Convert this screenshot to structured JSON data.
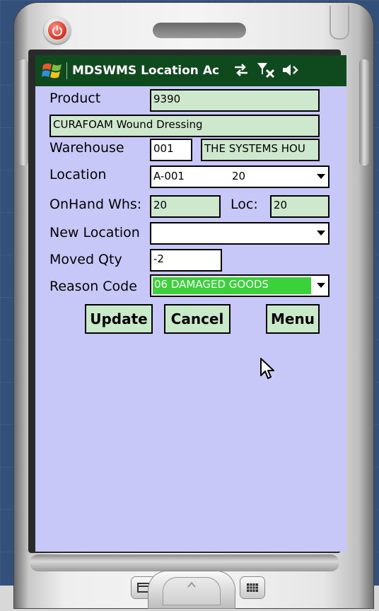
{
  "app": {
    "title": "MDSWMS Location Ac"
  },
  "status_icons": [
    "connectivity-icon",
    "no-signal-icon",
    "volume-icon"
  ],
  "form": {
    "product_label": "Product",
    "product_value": "9390",
    "product_description": "CURAFOAM Wound Dressing",
    "warehouse_label": "Warehouse",
    "warehouse_code": "001",
    "warehouse_name": "THE SYSTEMS HOU",
    "location_label": "Location",
    "location_value": "A-001",
    "location_qty": "20",
    "onhand_whs_label": "OnHand Whs:",
    "onhand_whs_value": "20",
    "loc_label": "Loc:",
    "loc_value": "20",
    "new_location_label": "New Location",
    "new_location_value": "",
    "moved_qty_label": "Moved Qty",
    "moved_qty_value": "-2",
    "reason_code_label": "Reason Code",
    "reason_code_value": "06 DAMAGED GOODS"
  },
  "buttons": {
    "update": "Update",
    "cancel": "Cancel",
    "menu": "Menu"
  },
  "colors": {
    "titlebar": "#0e4a1e",
    "screen_background": "#c8c8f8",
    "field_green": "#cde8cd",
    "selection_green": "#3ad13a"
  }
}
